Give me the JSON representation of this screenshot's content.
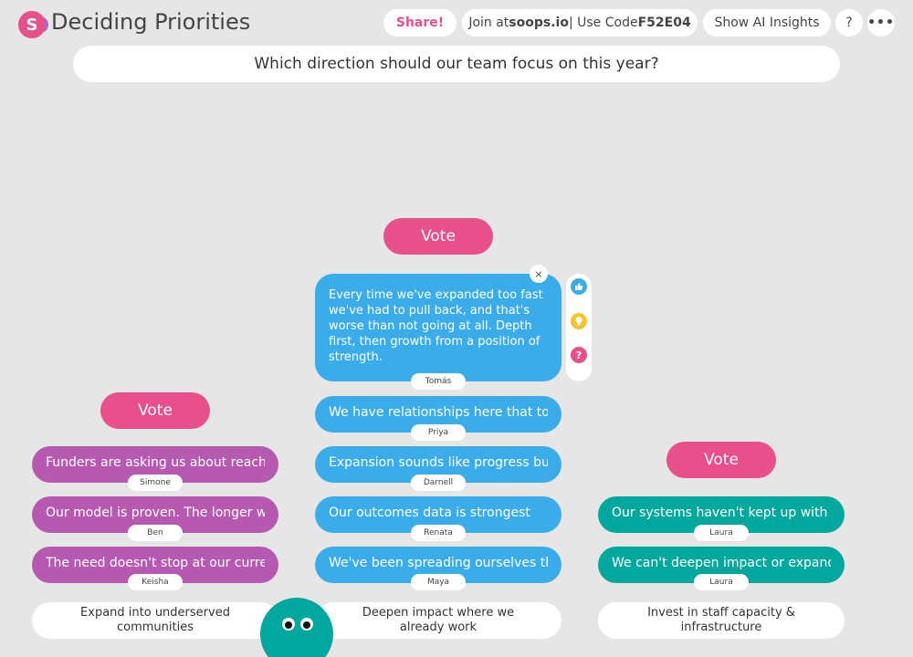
{
  "app": {
    "logo_letter": "S",
    "title": "Deciding Priorities"
  },
  "toolbar": {
    "share_label": "Share!",
    "join_prefix": "Join at ",
    "join_site": "soops.io",
    "join_mid": " | Use Code ",
    "join_code": "F52E04",
    "insights_label": "Show AI Insights",
    "help_label": "?",
    "more_label": "•••"
  },
  "question": "Which direction should our team focus on this year?",
  "columns": [
    {
      "vote_label": "Vote",
      "category": "Expand into underserved communities",
      "color": "#b55ab0",
      "cards": [
        {
          "text": "Funders are asking us about reach. If",
          "author": "Simone"
        },
        {
          "text": "Our model is proven. The longer we",
          "author": "Ben"
        },
        {
          "text": "The need doesn't stop at our current",
          "author": "Keisha"
        }
      ]
    },
    {
      "vote_label": "Vote",
      "category": "Deepen impact where we already work",
      "color": "#3aacea",
      "expanded_card": {
        "text": "Every time we've expanded too fast we've had to pull back, and that's worse than not going at all. Depth first, then growth from a position of strength.",
        "author": "Tomás",
        "close_label": "×"
      },
      "cards": [
        {
          "text": "We have relationships here that took",
          "author": "Priya"
        },
        {
          "text": "Expansion sounds like progress but it",
          "author": "Darnell"
        },
        {
          "text": "Our outcomes data is strongest",
          "author": "Renata"
        },
        {
          "text": "We've been spreading ourselves thin",
          "author": "Maya"
        }
      ]
    },
    {
      "vote_label": "Vote",
      "category": "Invest in staff capacity & infrastructure",
      "color": "#00a79d",
      "cards": [
        {
          "text": "Our systems haven't kept up with",
          "author": "Laura"
        },
        {
          "text": "We can't deepen impact or expand",
          "author": "Laura"
        }
      ]
    }
  ],
  "reactions": [
    {
      "icon": "thumbs-up-icon",
      "glyph": "👍",
      "color": "#3aacea"
    },
    {
      "icon": "lightbulb-icon",
      "glyph": "💡",
      "color": "#f4c430"
    },
    {
      "icon": "question-icon",
      "glyph": "?",
      "color": "#e8508b"
    }
  ]
}
